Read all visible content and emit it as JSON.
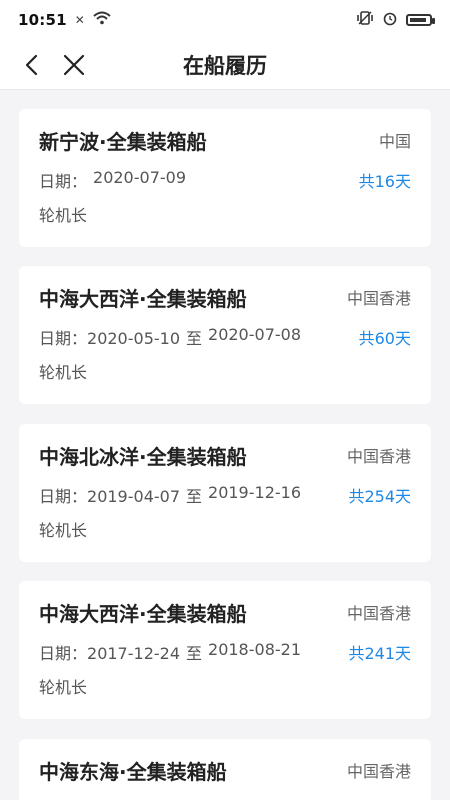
{
  "status": {
    "time": "10:51",
    "small": "✕",
    "wifi_icon": "wifi-icon",
    "vibrate_icon": "vibrate-icon",
    "alarm_icon": "alarm-icon",
    "battery_icon": "battery-icon",
    "battery_level": 0.88
  },
  "header": {
    "title": "在船履历",
    "back_icon": "back-arrow-icon",
    "close_icon": "close-icon"
  },
  "records": [
    {
      "ship": "新宁波·全集装箱船",
      "region": "中国",
      "date_label": "日期：",
      "start": "2020-07-09",
      "to": "",
      "end": "",
      "days": "共16天",
      "position": "轮机长"
    },
    {
      "ship": "中海大西洋·全集装箱船",
      "region": "中国香港",
      "date_label": "日期：",
      "start": "2020-05-10",
      "to": "至",
      "end": "2020-07-08",
      "days": "共60天",
      "position": "轮机长"
    },
    {
      "ship": "中海北冰洋·全集装箱船",
      "region": "中国香港",
      "date_label": "日期：",
      "start": "2019-04-07",
      "to": "至",
      "end": "2019-12-16",
      "days": "共254天",
      "position": "轮机长"
    },
    {
      "ship": "中海大西洋·全集装箱船",
      "region": "中国香港",
      "date_label": "日期：",
      "start": "2017-12-24",
      "to": "至",
      "end": "2018-08-21",
      "days": "共241天",
      "position": "轮机长"
    },
    {
      "ship": "中海东海·全集装箱船",
      "region": "中国香港",
      "date_label": "",
      "start": "",
      "to": "",
      "end": "",
      "days": "",
      "position": ""
    }
  ],
  "colors": {
    "accent": "#1e88e5",
    "background": "#f4f4f6",
    "card": "#ffffff"
  }
}
